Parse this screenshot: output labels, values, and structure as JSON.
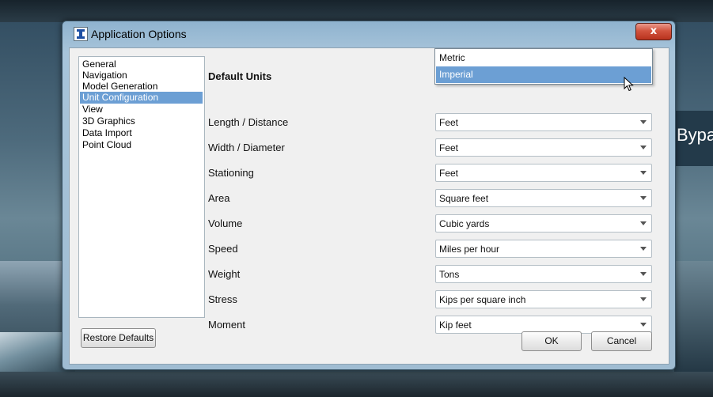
{
  "background": {
    "right_edge_text": "Bypa"
  },
  "window": {
    "title": "Application Options",
    "close_label": "x"
  },
  "nav": {
    "items": [
      {
        "label": "General"
      },
      {
        "label": "Navigation"
      },
      {
        "label": "Model Generation"
      },
      {
        "label": "Unit Configuration",
        "selected": true
      },
      {
        "label": "View"
      },
      {
        "label": "3D Graphics"
      },
      {
        "label": "Data Import"
      },
      {
        "label": "Point Cloud"
      }
    ]
  },
  "default_units": {
    "heading": "Default Units",
    "dropdown_open": {
      "options": [
        "Metric",
        "Imperial"
      ],
      "highlighted": "Imperial"
    },
    "rows": [
      {
        "label": "Length / Distance",
        "value": "Feet"
      },
      {
        "label": "Width / Diameter",
        "value": "Feet"
      },
      {
        "label": "Stationing",
        "value": "Feet"
      },
      {
        "label": "Area",
        "value": "Square feet"
      },
      {
        "label": "Volume",
        "value": "Cubic yards"
      },
      {
        "label": "Speed",
        "value": "Miles per hour"
      },
      {
        "label": "Weight",
        "value": "Tons"
      },
      {
        "label": "Stress",
        "value": "Kips per square inch"
      },
      {
        "label": "Moment",
        "value": "Kip feet"
      }
    ]
  },
  "buttons": {
    "restore_defaults": "Restore Defaults",
    "ok": "OK",
    "cancel": "Cancel"
  },
  "colors": {
    "selection": "#6c9fd4",
    "close_button": "#c8412b"
  }
}
